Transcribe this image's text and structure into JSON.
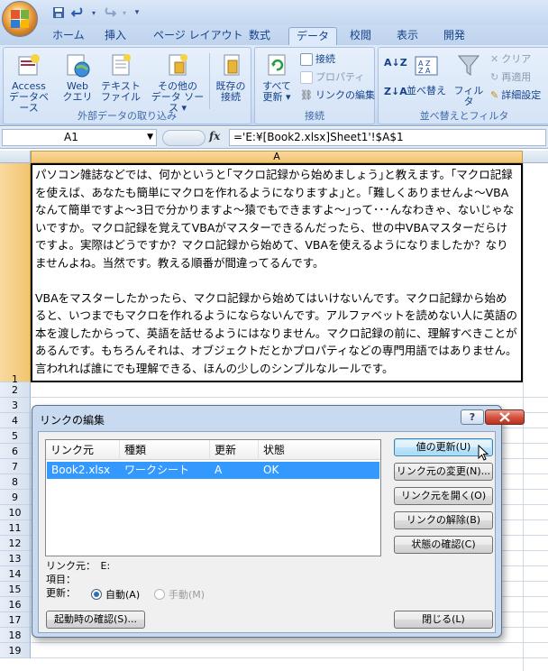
{
  "qat": {
    "save": "save-icon",
    "undo": "undo-icon",
    "redo": "redo-icon"
  },
  "tabs": [
    "ホーム",
    "挿入",
    "ページ レイアウト",
    "数式",
    "データ",
    "校閲",
    "表示",
    "開発"
  ],
  "ribbon": {
    "group_external": {
      "label": "外部データの取り込み",
      "access": [
        "Access",
        "データベース"
      ],
      "web": [
        "Web",
        "クエリ"
      ],
      "text": [
        "テキスト",
        "ファイル"
      ],
      "other": [
        "その他の",
        "データ ソース ▾"
      ],
      "existing": [
        "既存の",
        "接続"
      ]
    },
    "group_connect": {
      "label": "接続",
      "refresh": [
        "すべて",
        "更新 ▾"
      ],
      "connections": "接続",
      "properties": "プロパティ",
      "edit_links": "リンクの編集"
    },
    "group_sort": {
      "label": "並べ替えとフィルタ",
      "sort": "並べ替え",
      "filter": "フィルタ",
      "clear": "クリア",
      "reapply": "再適用",
      "advanced": "詳細設定"
    }
  },
  "formula_bar": {
    "name": "A1",
    "formula": "='E:¥[Book2.xlsx]Sheet1'!$A$1"
  },
  "sheet": {
    "col_a": "A",
    "a1_paragraphs": [
      "パソコン雑誌などでは、何かというと｢マクロ記録から始めましょう｣と教えます。｢マクロ記録を使えば、あなたも簡単にマクロを作れるようになりますよ｣と。｢難しくありませんよ～VBAなんて簡単ですよ～3日で分かりますよ～猿でもできますよ～｣って･･･んなわきゃ、ないじゃないですか。マクロ記録を覚えてVBAがマスターできるんだったら、世の中VBAマスターだらけですよ。実際はどうですか？マクロ記録から始めて、VBAを使えるようになりましたか？なりませんよね。当然です。教える順番が間違ってるんです。",
      "VBAをマスターしたかったら、マクロ記録から始めてはいけないんです。マクロ記録から始めると、いつまでもマクロを作れるようにならないんです。アルファベットを読めない人に英語の本を渡したからって、英語を話せるようにはなりません。マクロ記録の前に、理解すべきことがあるんです。もちろんそれは、オブジェクトだとかプロパティなどの専門用語ではありません。言われれば誰にでも理解できる、ほんの少しのシンプルなルールです。"
    ],
    "rows": [
      "1",
      "2",
      "3",
      "4",
      "5",
      "6",
      "7",
      "8",
      "9",
      "10",
      "11",
      "12",
      "13",
      "14",
      "15",
      "16",
      "17",
      "18",
      "19"
    ]
  },
  "dialog": {
    "title": "リンクの編集",
    "help": "?",
    "columns": [
      "リンク元",
      "種類",
      "更新",
      "状態"
    ],
    "rows": [
      [
        "Book2.xlsx",
        "ワークシート",
        "A",
        "OK"
      ]
    ],
    "buttons": {
      "update": "値の更新(U)",
      "change": "リンク元の変更(N)...",
      "open": "リンク元を開く(O)",
      "break": "リンクの解除(B)",
      "check": "状態の確認(C)",
      "startup": "起動時の確認(S)...",
      "close": "閉じる(L)"
    },
    "info": {
      "source": "リンク元：　E:",
      "item": "項目：",
      "update": "更新："
    },
    "radio_auto": "自動(A)",
    "radio_manual": "手動(M)"
  }
}
